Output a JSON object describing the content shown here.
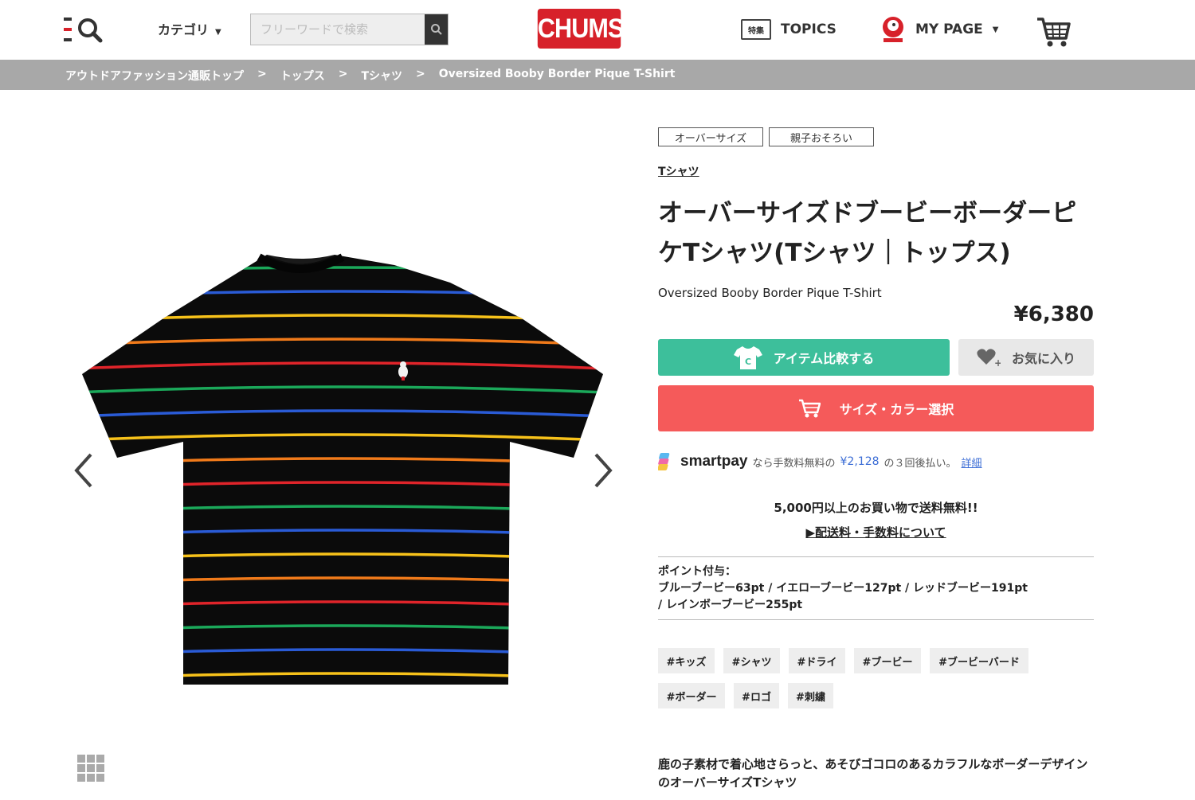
{
  "header": {
    "category_label": "カテゴリ",
    "search_placeholder": "フリーワードで検索",
    "logo_text": "CHUMS",
    "topics_tag": "特集",
    "topics_label": "TOPICS",
    "mypage_label": "MY PAGE"
  },
  "breadcrumb": {
    "items": [
      "アウトドアファッション通販トップ",
      "トップス",
      "Tシャツ",
      "Oversized Booby Border Pique T-Shirt"
    ],
    "separator": ">"
  },
  "product": {
    "badges": [
      "オーバーサイズ",
      "親子おそろい"
    ],
    "category_link": "Tシャツ",
    "title": "オーバーサイズドブービーボーダーピケTシャツ(Tシャツ｜トップス)",
    "title_line1": "オーバーサイズドブービーボーダーピ",
    "title_line2": "ケTシャツ(Tシャツ｜トップス)",
    "name_en": "Oversized Booby Border Pique T-Shirt",
    "price": "¥6,380",
    "compare_label": "アイテム比較する",
    "favorite_label": "お気に入り",
    "size_color_label": "サイズ・カラー選択",
    "smartpay": {
      "brand": "smartpay",
      "text_before": "なら手数料無料の",
      "amount": "¥2,128",
      "text_after": "の３回後払い。",
      "detail_link": "詳細"
    },
    "free_shipping": "5,000円以上のお買い物で送料無料!!",
    "shipping_link": "▶配送料・手数料について",
    "points": {
      "label": "ポイント付与：",
      "line1": "ブルーブービー63pt / イエローブービー127pt / レッドブービー191pt",
      "line2": " / レインボーブービー255pt"
    },
    "hashtags": [
      "#キッズ",
      "#シャツ",
      "#ドライ",
      "#ブービー",
      "#ブービーバード",
      "#ボーダー",
      "#ロゴ",
      "#刺繍"
    ],
    "description": "鹿の子素材で着心地さらっと、あそびゴコロのあるカラフルなボーダーデザインのオーバーサイズTシャツ"
  },
  "colors": {
    "brand_red": "#d7212a",
    "compare_green": "#3dbf9b",
    "size_button_red": "#f55a5a",
    "breadcrumb_gray": "#a8a8a8"
  },
  "icons": [
    "menu-search-icon",
    "search-icon",
    "topics-icon",
    "login-avatar-icon",
    "cart-icon",
    "tshirt-icon",
    "heart-icon",
    "cart-small-icon",
    "smartpay-logo-icon",
    "chevron-left-icon",
    "chevron-right-icon",
    "grid-icon"
  ]
}
